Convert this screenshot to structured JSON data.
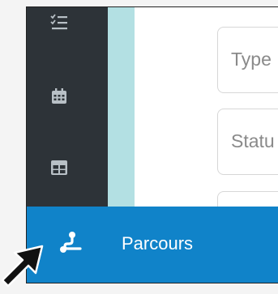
{
  "sidebar": {
    "items": [
      {
        "icon": "checklist-icon"
      },
      {
        "icon": "calendar-icon"
      },
      {
        "icon": "table-icon"
      },
      {
        "icon": "route-icon",
        "label": "Parcours",
        "active": true
      }
    ]
  },
  "form": {
    "type_placeholder": "Type",
    "status_placeholder": "Statu"
  },
  "colors": {
    "sidebar_bg": "#2d3338",
    "accent": "#1083c9",
    "teal_strip": "#b3e0e3"
  }
}
